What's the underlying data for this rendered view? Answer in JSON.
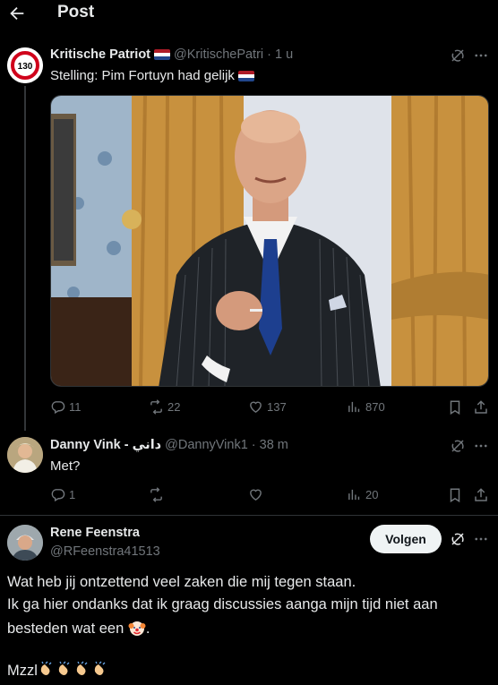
{
  "header": {
    "title": "Post"
  },
  "main_post": {
    "author_name": "Kritische Patriot",
    "handle": "@KritischePatri",
    "time": "· 1 u",
    "avatar_text": "130",
    "text": "Stelling: Pim Fortuyn had gelijk",
    "metrics": {
      "replies": "11",
      "reposts": "22",
      "likes": "137",
      "views": "870"
    }
  },
  "reply_1": {
    "author_name": "Danny Vink - داني",
    "handle": "@DannyVink1",
    "time": "· 38 m",
    "text": "Met?",
    "metrics": {
      "replies": "1",
      "reposts": "",
      "likes": "",
      "views": "20"
    }
  },
  "reply_2": {
    "author_name": "Rene Feenstra",
    "handle": "@RFeenstra41513",
    "follow_label": "Volgen",
    "lines": [
      "Wat heb jij ontzettend veel zaken die mij tegen staan.",
      "Ik ga hier ondanks dat ik graag discussies aanga mijn tijd niet aan",
      "besteden wat een",
      "."
    ],
    "sign_off": "Mzzl"
  },
  "icons": {
    "back": "arrow-left-icon",
    "grok": "grok-icon",
    "more": "more-icon",
    "reply": "reply-icon",
    "repost": "repost-icon",
    "like": "heart-icon",
    "views": "views-icon",
    "bookmark": "bookmark-icon",
    "share": "share-icon",
    "flag": "netherlands-flag-icon",
    "clown": "clown-face-icon",
    "clap": "clapping-hands-icon"
  },
  "colors": {
    "background": "#000000",
    "text": "#e7e9ea",
    "muted": "#71767b",
    "divider": "#2f3336",
    "button_bg": "#eff3f4"
  }
}
